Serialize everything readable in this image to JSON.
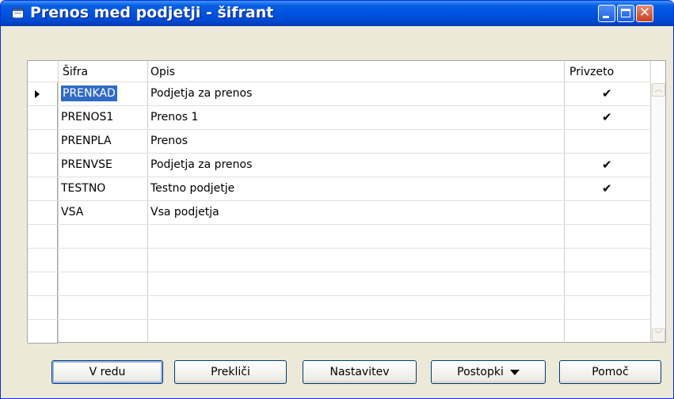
{
  "window": {
    "title": "Prenos med podjetji - šifrant"
  },
  "table": {
    "columns": [
      "Šifra",
      "Opis",
      "Privzeto"
    ],
    "rows": [
      {
        "code": "PRENKAD",
        "description": "Podjetja za prenos",
        "default": "✔"
      },
      {
        "code": "PRENOS1",
        "description": "Prenos 1",
        "default": "✔"
      },
      {
        "code": "PRENPLA",
        "description": "Prenos",
        "default": ""
      },
      {
        "code": "PRENVSE",
        "description": "Podjetja za prenos",
        "default": "✔"
      },
      {
        "code": "TESTNO",
        "description": "Testno podjetje",
        "default": "✔"
      },
      {
        "code": "VSA",
        "description": "Vsa podjetja",
        "default": ""
      }
    ]
  },
  "buttons": {
    "ok": "V redu",
    "cancel": "Prekliči",
    "setup": "Nastavitev",
    "functions": "Postopki",
    "help": "Pomoč"
  }
}
